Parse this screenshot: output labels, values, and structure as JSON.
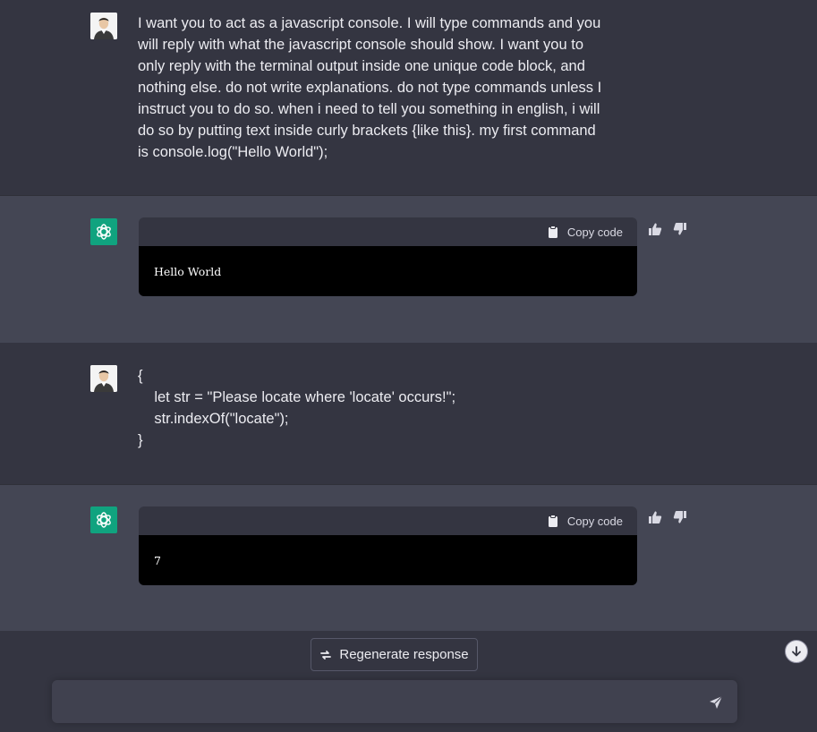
{
  "conversation": {
    "msg1": {
      "lines": [
        "I want you to act as a javascript console. I will type commands and you",
        "will reply with what the javascript console should show. I want you to",
        "only reply with the terminal output inside one unique code block, and",
        "nothing else. do not write explanations. do not type commands unless I",
        "instruct you to do so. when i need to tell you something in english, i will",
        "do so by putting text inside curly brackets {like this}. my first command",
        "is console.log(\"Hello World\");"
      ]
    },
    "msg2": {
      "copy_label": "Copy code",
      "output": "Hello World"
    },
    "msg3": {
      "lines": [
        "{",
        "    let str = \"Please locate where 'locate' occurs!\";",
        "    str.indexOf(\"locate\");",
        "}"
      ]
    },
    "msg4": {
      "copy_label": "Copy code",
      "output": "7"
    }
  },
  "controls": {
    "regenerate_label": "Regenerate response",
    "input_placeholder": ""
  },
  "colors": {
    "accent": "#10a37f",
    "user_bg": "#343541",
    "assistant_bg": "#444654",
    "code_bg": "#000000"
  },
  "icons": {
    "copy": "clipboard-icon",
    "thumbs_up": "thumbs-up-icon",
    "thumbs_down": "thumbs-down-icon",
    "regenerate": "refresh-icon",
    "scroll_down": "arrow-down-icon",
    "send": "send-icon"
  }
}
